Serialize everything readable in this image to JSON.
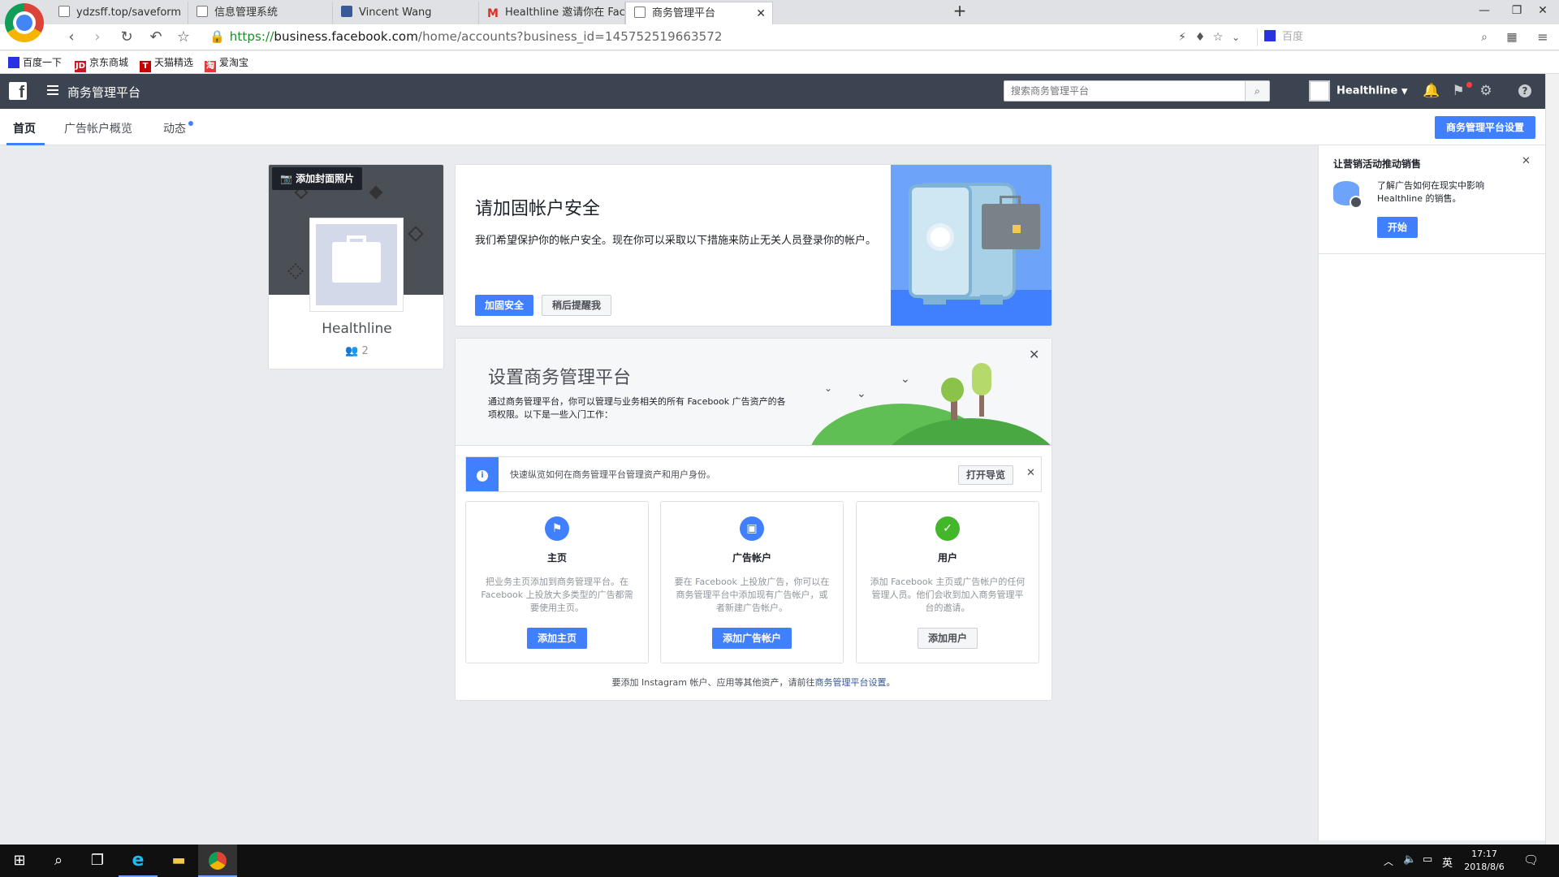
{
  "browser": {
    "tabs": [
      {
        "label": "ydzsff.top/saveform"
      },
      {
        "label": "信息管理系统"
      },
      {
        "label": "Vincent Wang"
      },
      {
        "label": "Healthline 邀请你在 Facebook 主"
      },
      {
        "label": "商务管理平台"
      }
    ],
    "url": {
      "scheme": "https://",
      "host": "business.facebook.com",
      "rest": "/home/accounts?business_id=145752519663572"
    },
    "search_placeholder": "百度",
    "bookmarks": [
      {
        "label": "百度一下"
      },
      {
        "label": "京东商城"
      },
      {
        "label": "天猫精选"
      },
      {
        "label": "爱淘宝"
      }
    ]
  },
  "fb": {
    "app_title": "商务管理平台",
    "search_placeholder": "搜索商务管理平台",
    "account_name": "Healthline",
    "subnav": {
      "home": "首页",
      "ad_overview": "广告帐户概览",
      "activity": "动态",
      "settings_button": "商务管理平台设置"
    }
  },
  "profile": {
    "add_cover": "添加封面照片",
    "name": "Healthline",
    "member_count": "2"
  },
  "security": {
    "title": "请加固帐户安全",
    "desc": "我们希望保护你的帐户安全。现在你可以采取以下措施来防止无关人员登录你的帐户。",
    "primary_button": "加固安全",
    "secondary_button": "稍后提醒我"
  },
  "setup": {
    "title": "设置商务管理平台",
    "desc": "通过商务管理平台，你可以管理与业务相关的所有 Facebook 广告资产的各项权限。以下是一些入门工作：",
    "info_text": "快速纵览如何在商务管理平台管理资产和用户身份。",
    "info_button": "打开导览",
    "features": [
      {
        "title": "主页",
        "desc": "把业务主页添加到商务管理平台。在 Facebook 上投放大多类型的广告都需要使用主页。",
        "button": "添加主页",
        "color": "#4080ff"
      },
      {
        "title": "广告帐户",
        "desc": "要在 Facebook 上投放广告，你可以在商务管理平台中添加现有广告帐户，或者新建广告帐户。",
        "button": "添加广告帐户",
        "color": "#4080ff"
      },
      {
        "title": "用户",
        "desc": "添加 Facebook 主页或广告帐户的任何管理人员。他们会收到加入商务管理平台的邀请。",
        "button": "添加用户",
        "color": "#42b72a"
      }
    ],
    "footer_prefix": "要添加 Instagram 帐户、应用等其他资产，请前往",
    "footer_link": "商务管理平台设置",
    "footer_suffix": "。"
  },
  "promo": {
    "title": "让营销活动推动销售",
    "desc": "了解广告如何在现实中影响 Healthline 的销售。",
    "button": "开始"
  },
  "taskbar": {
    "ime": "英",
    "time": "17:17",
    "date": "2018/8/6"
  }
}
